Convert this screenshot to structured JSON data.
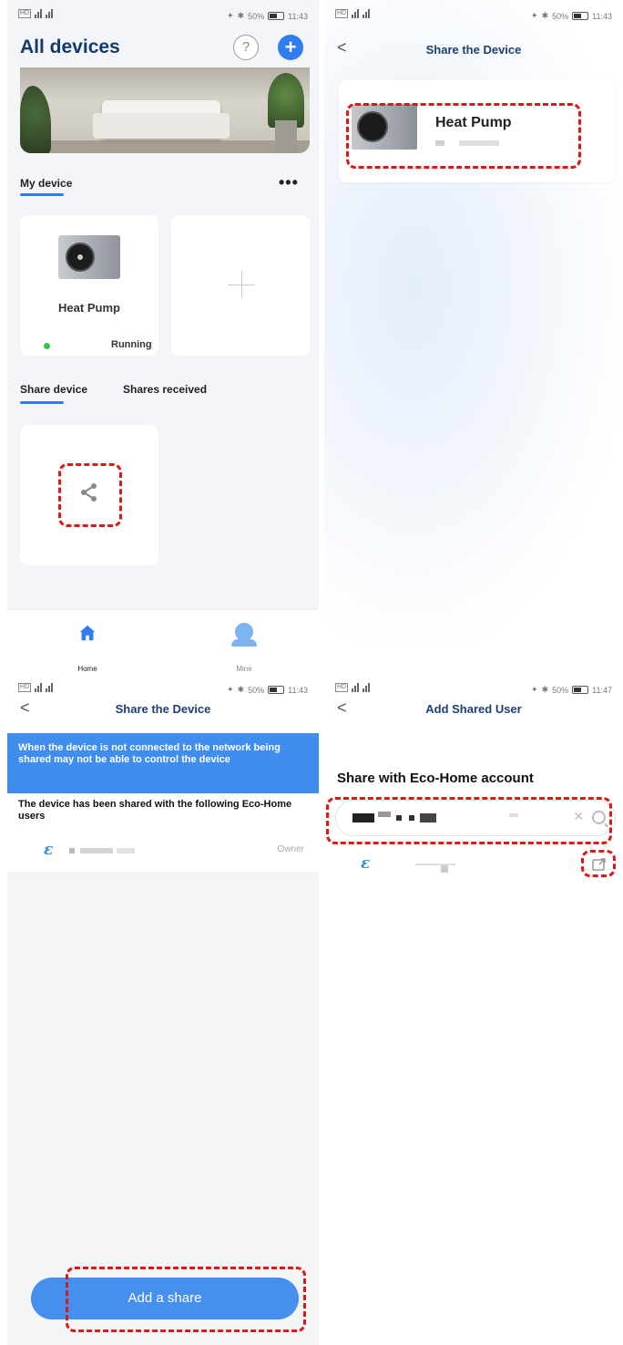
{
  "panel1": {
    "title": "All devices",
    "help_icon": "question-icon",
    "add_icon": "plus-icon",
    "my_device_tab": "My device",
    "more_icon": "more-dots-icon",
    "device": {
      "name": "Heat Pump",
      "status": "Running",
      "status_color": "#2ecc40"
    },
    "add_device_icon": "plus-icon",
    "share_tabs": [
      "Share device",
      "Shares received"
    ],
    "share_icon": "share-icon",
    "nav": [
      {
        "label": "Home",
        "icon": "home-icon"
      },
      {
        "label": "Mine",
        "icon": "user-icon"
      }
    ]
  },
  "panel2": {
    "title": "Share the Device",
    "device_name": "Heat Pump"
  },
  "panel3": {
    "title": "Share the Device",
    "notice": "When the device is not connected to the network being shared may not be able to control the device",
    "shared_with_title": "The device has been shared with the following Eco-Home users",
    "user": {
      "role": "Owner"
    },
    "add_share_label": "Add a share"
  },
  "panel4": {
    "title": "Add Shared User",
    "heading": "Share with Eco-Home account",
    "search_value": "",
    "clear_icon": "close-icon",
    "search_icon": "search-icon",
    "share_action_icon": "share-out-icon"
  },
  "colors": {
    "accent": "#2f7df0",
    "highlight": "#e01515",
    "title_blue": "#1d4070"
  }
}
